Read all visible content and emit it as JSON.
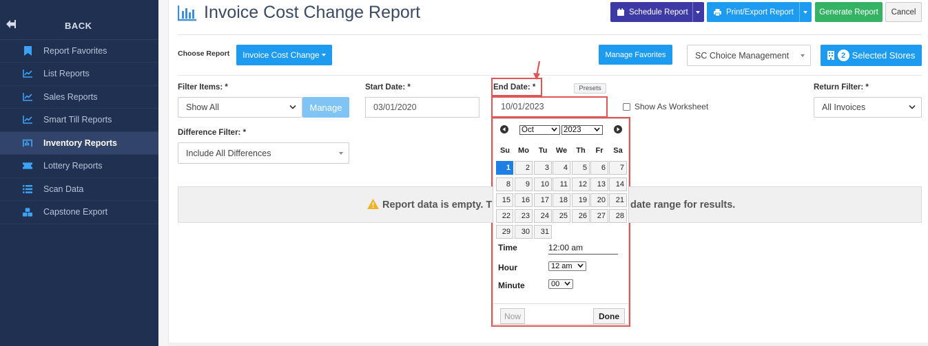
{
  "sidebar": {
    "back_label": "BACK",
    "items": [
      {
        "label": "Report Favorites",
        "icon": "bookmark-icon"
      },
      {
        "label": "List Reports",
        "icon": "line-chart-icon"
      },
      {
        "label": "Sales Reports",
        "icon": "line-chart-icon"
      },
      {
        "label": "Smart Till Reports",
        "icon": "line-chart-icon"
      },
      {
        "label": "Inventory Reports",
        "icon": "warehouse-icon",
        "active": true
      },
      {
        "label": "Lottery Reports",
        "icon": "ticket-icon"
      },
      {
        "label": "Scan Data",
        "icon": "list-icon"
      },
      {
        "label": "Capstone Export",
        "icon": "cubes-icon"
      }
    ]
  },
  "header": {
    "title": "Invoice Cost Change Report",
    "schedule_label": "Schedule Report",
    "print_label": "Print/Export Report",
    "generate_label": "Generate Report",
    "cancel_label": "Cancel"
  },
  "choose": {
    "label": "Choose Report",
    "report_button": "Invoice Cost Change",
    "manage_favorites": "Manage Favorites",
    "company": "SC Choice Management",
    "stores_count": "2",
    "stores_label": "Selected Stores"
  },
  "filters": {
    "filter_items_label": "Filter Items: *",
    "filter_items_value": "Show All",
    "manage_label": "Manage",
    "start_date_label": "Start Date: *",
    "start_date_value": "03/01/2020",
    "end_date_label": "End Date: *",
    "end_date_value": "10/01/2023",
    "presets_label": "Presets",
    "worksheet_label": "Show As Worksheet",
    "return_filter_label": "Return Filter: *",
    "return_filter_value": "All Invoices",
    "difference_filter_label": "Difference Filter: *",
    "difference_filter_value": "Include All Differences"
  },
  "empty_message": {
    "left": "Report data is empty. T",
    "right": "date range for results."
  },
  "calendar": {
    "month": "Oct",
    "year": "2023",
    "dow": [
      "Su",
      "Mo",
      "Tu",
      "We",
      "Th",
      "Fr",
      "Sa"
    ],
    "days": [
      "1",
      "2",
      "3",
      "4",
      "5",
      "6",
      "7",
      "8",
      "9",
      "10",
      "11",
      "12",
      "13",
      "14",
      "15",
      "16",
      "17",
      "18",
      "19",
      "20",
      "21",
      "22",
      "23",
      "24",
      "25",
      "26",
      "27",
      "28",
      "29",
      "30",
      "31"
    ],
    "selected_day": "1",
    "time_label": "Time",
    "time_value": "12:00 am",
    "hour_label": "Hour",
    "hour_value": "12 am",
    "minute_label": "Minute",
    "minute_value": "00",
    "now_label": "Now",
    "done_label": "Done"
  },
  "colors": {
    "sidebar_bg": "#1f3050",
    "primary_blue": "#1d9bf0",
    "schedule_purple": "#3d3aa6",
    "generate_green": "#34b364",
    "highlight_red": "#e05555"
  }
}
